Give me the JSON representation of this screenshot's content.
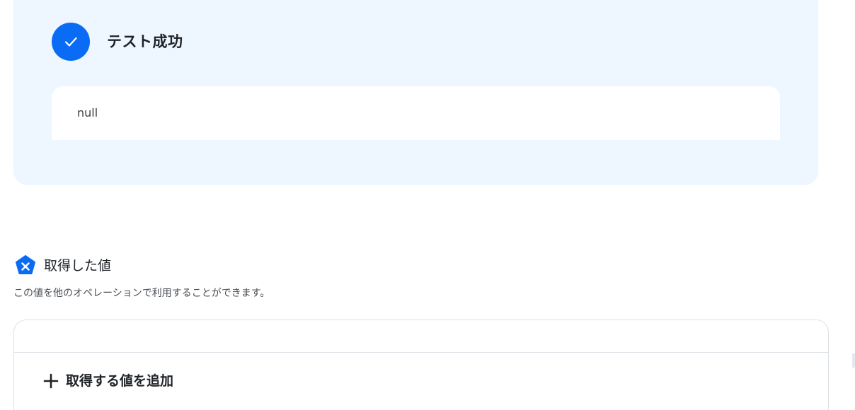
{
  "result": {
    "title": "テスト成功",
    "output": "null"
  },
  "acquired": {
    "title": "取得した値",
    "description": "この値を他のオペレーションで利用することができます。",
    "add_label": "取得する値を追加"
  },
  "colors": {
    "accent": "#0a6cf5",
    "panel_bg": "#eef6ff",
    "border": "#dde1e6"
  },
  "icons": {
    "success": "check-icon",
    "variable": "variable-hex-icon",
    "add": "plus-icon"
  }
}
